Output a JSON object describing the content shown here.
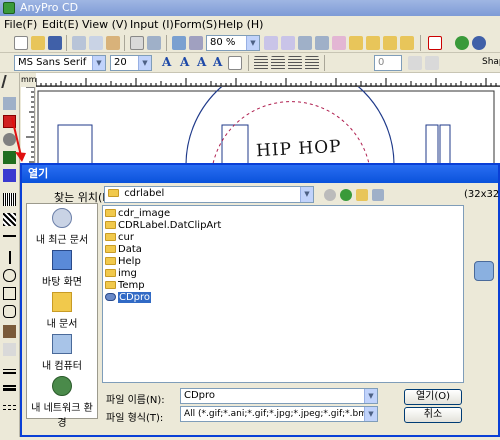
{
  "app": {
    "title": "AnyPro CD"
  },
  "menu": [
    {
      "label": "File(F)"
    },
    {
      "label": "Edit(E)"
    },
    {
      "label": "View (V)"
    },
    {
      "label": "Input (I)"
    },
    {
      "label": "Form(S)"
    },
    {
      "label": "Help (H)"
    }
  ],
  "toolbar": {
    "zoom": "80 %"
  },
  "format_bar": {
    "font": "MS Sans Serif",
    "size": "20",
    "shap_label": "Shap",
    "field_value": "0"
  },
  "ruler": {
    "unit": "mm"
  },
  "canvas": {
    "label_text": "HIP HOP"
  },
  "dialog": {
    "title": "열기",
    "look_in_label": "찾는 위치(I):",
    "look_in_value": "cdrlabel",
    "size_label": "(32x32)",
    "places": [
      {
        "label": "내 최근 문서",
        "icon": "recent-documents-icon"
      },
      {
        "label": "바탕 화면",
        "icon": "desktop-icon"
      },
      {
        "label": "내 문서",
        "icon": "my-documents-icon"
      },
      {
        "label": "내 컴퓨터",
        "icon": "my-computer-icon"
      },
      {
        "label": "내 네트워크 환경",
        "icon": "network-icon"
      }
    ],
    "files": [
      {
        "name": "cdr_image",
        "type": "folder"
      },
      {
        "name": "CDRLabel.DatClipArt",
        "type": "folder"
      },
      {
        "name": "cur",
        "type": "folder"
      },
      {
        "name": "Data",
        "type": "folder"
      },
      {
        "name": "Help",
        "type": "folder"
      },
      {
        "name": "img",
        "type": "folder"
      },
      {
        "name": "Temp",
        "type": "folder"
      },
      {
        "name": "CDpro",
        "type": "file"
      }
    ],
    "filename_label": "파일 이름(N):",
    "filename_value": "CDpro",
    "filetype_label": "파일 형식(T):",
    "filetype_value": "All (*.gif;*.ani;*.gif;*.jpg;*.jpeg;*.gif;*.bmp;*.ic",
    "open_button": "열기(O)",
    "cancel_button": "취소"
  },
  "colors": {
    "dialog_border": "#0a3fd6",
    "selection": "#316ac5",
    "titlebar": "#7e9bd6"
  }
}
